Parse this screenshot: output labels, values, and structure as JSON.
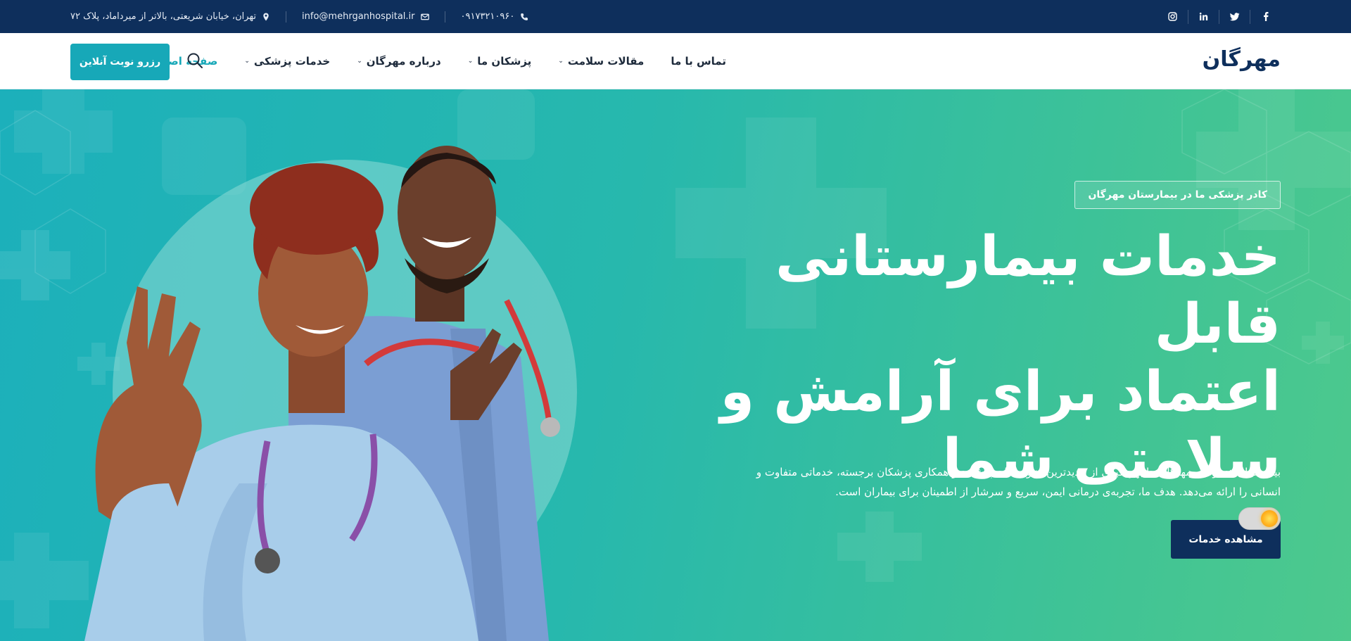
{
  "topbar": {
    "address": "تهران، خیابان شریعتی، بالاتر از میرداماد، پلاک ۷۲",
    "email": "info@mehrganhospital.ir",
    "phone": "۰۹۱۷۳۲۱۰۹۶۰",
    "social": [
      "instagram",
      "linkedin",
      "twitter",
      "facebook"
    ]
  },
  "navbar": {
    "logo": "مهرگان",
    "menu": [
      {
        "label": "صفحه اصلی",
        "dropdown": false,
        "active": true
      },
      {
        "label": "خدمات پزشکی",
        "dropdown": true,
        "active": false
      },
      {
        "label": "درباره مهرگان",
        "dropdown": true,
        "active": false
      },
      {
        "label": "پزشکان ما",
        "dropdown": true,
        "active": false
      },
      {
        "label": "مقالات سلامت",
        "dropdown": true,
        "active": false
      },
      {
        "label": "تماس با ما",
        "dropdown": false,
        "active": false
      }
    ],
    "search_icon": "search-icon",
    "book_button": "رزرو نوبت آنلاین"
  },
  "hero": {
    "tag": "کادر پزشکی ما در بیمارستان مهرگان",
    "headline_line1": "خدمات بیمارستانی قابل",
    "headline_line2": "اعتماد برای آرامش و",
    "headline_line3": "سلامتی شما",
    "paragraph_line1": "بیمارستان خصوصی مهرگان، با بهره‌گیری از جدیدترین فناوری‌های پزشکی و همکاری پزشکان برجسته، خدماتی متفاوت و",
    "paragraph_line2": "انسانی را ارائه می‌دهد. هدف ما، تجربه‌ی درمانی ایمن، سریع و سرشار از اطمینان برای بیماران است.",
    "button": "مشاهده خدمات",
    "toggle_on": true
  },
  "colors": {
    "topbar_bg": "#0e2f5c",
    "accent": "#17a8b8",
    "hero_start": "#1cb0bb",
    "hero_end": "#4dc98d",
    "dark_button": "#0e2f5c"
  }
}
